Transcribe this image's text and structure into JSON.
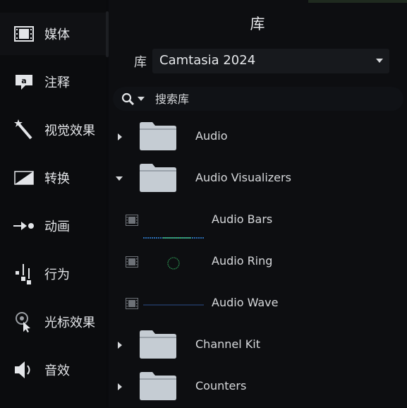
{
  "sidebar": {
    "items": [
      {
        "label": "媒体",
        "icon": "film-strip-icon",
        "active": true
      },
      {
        "label": "注释",
        "icon": "callout-icon"
      },
      {
        "label": "视觉效果",
        "icon": "magic-wand-icon"
      },
      {
        "label": "转换",
        "icon": "transition-icon"
      },
      {
        "label": "动画",
        "icon": "animation-icon"
      },
      {
        "label": "行为",
        "icon": "behaviors-icon"
      },
      {
        "label": "光标效果",
        "icon": "cursor-effects-icon"
      },
      {
        "label": "音效",
        "icon": "audio-effects-icon"
      }
    ]
  },
  "panel": {
    "title": "库",
    "library_label": "库",
    "library_selected": "Camtasia 2024",
    "search_placeholder": "搜索库"
  },
  "tree": [
    {
      "label": "Audio",
      "type": "folder",
      "expanded": false
    },
    {
      "label": "Audio Visualizers",
      "type": "folder",
      "expanded": true
    },
    {
      "label": "Audio Bars",
      "type": "item"
    },
    {
      "label": "Audio Ring",
      "type": "item"
    },
    {
      "label": "Audio Wave",
      "type": "item"
    },
    {
      "label": "Channel Kit",
      "type": "folder",
      "expanded": false
    },
    {
      "label": "Counters",
      "type": "folder",
      "expanded": false
    }
  ],
  "colors": {
    "background": "#0a0b0d",
    "panel": "#0d0e11",
    "folder": "#c5ccd3",
    "text": "#d6d8db"
  }
}
